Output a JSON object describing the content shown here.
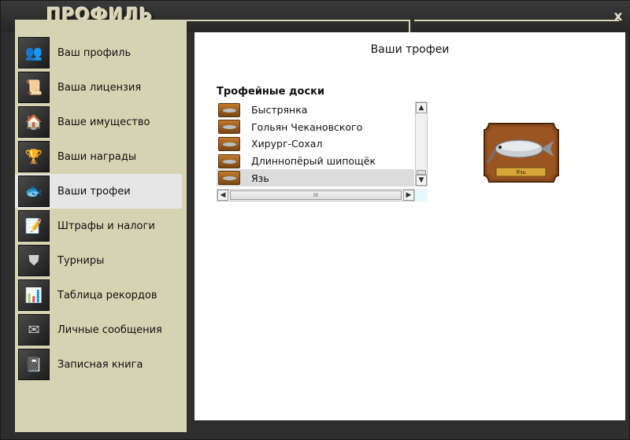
{
  "window": {
    "title": "ПРОФИЛЬ",
    "close_glyph": "x"
  },
  "sidebar": {
    "items": [
      {
        "label": "Ваш профиль",
        "icon": "people-icon",
        "glyph": "👥"
      },
      {
        "label": "Ваша лицензия",
        "icon": "license-icon",
        "glyph": "📜"
      },
      {
        "label": "Ваше имущество",
        "icon": "house-icon",
        "glyph": "🏠"
      },
      {
        "label": "Ваши награды",
        "icon": "trophy-cup-icon",
        "glyph": "🏆"
      },
      {
        "label": "Ваши трофеи",
        "icon": "fish-trophy-icon",
        "glyph": "🐟"
      },
      {
        "label": "Штрафы и налоги",
        "icon": "document-pen-icon",
        "glyph": "📝"
      },
      {
        "label": "Турниры",
        "icon": "tournament-emblem-icon",
        "glyph": "⛊"
      },
      {
        "label": "Таблица рекордов",
        "icon": "bar-chart-icon",
        "glyph": "📊"
      },
      {
        "label": "Личные сообщения",
        "icon": "envelope-icon",
        "glyph": "✉"
      },
      {
        "label": "Записная книга",
        "icon": "notebook-icon",
        "glyph": "📓"
      }
    ],
    "active_index": 4
  },
  "main": {
    "title": "Ваши трофеи",
    "section_title": "Трофейные доски",
    "list": [
      {
        "label": "Быстрянка"
      },
      {
        "label": "Гольян Чекановского"
      },
      {
        "label": "Хирург-Сохал"
      },
      {
        "label": "Длиннопёрый шипощёк"
      },
      {
        "label": "Язь"
      }
    ],
    "selected_index": 4,
    "plaque_label": "Язь",
    "scroll": {
      "up": "▲",
      "down": "▼",
      "left": "◀",
      "right": "▶",
      "grip": "III"
    }
  },
  "colors": {
    "sidebar_bg": "#d6d3b3",
    "frame_bg": "#2e2e2e",
    "active_item_bg": "#e6e6e6",
    "selected_row_bg": "#dcdcdc",
    "plaque_wood": "#8a4a1c"
  }
}
